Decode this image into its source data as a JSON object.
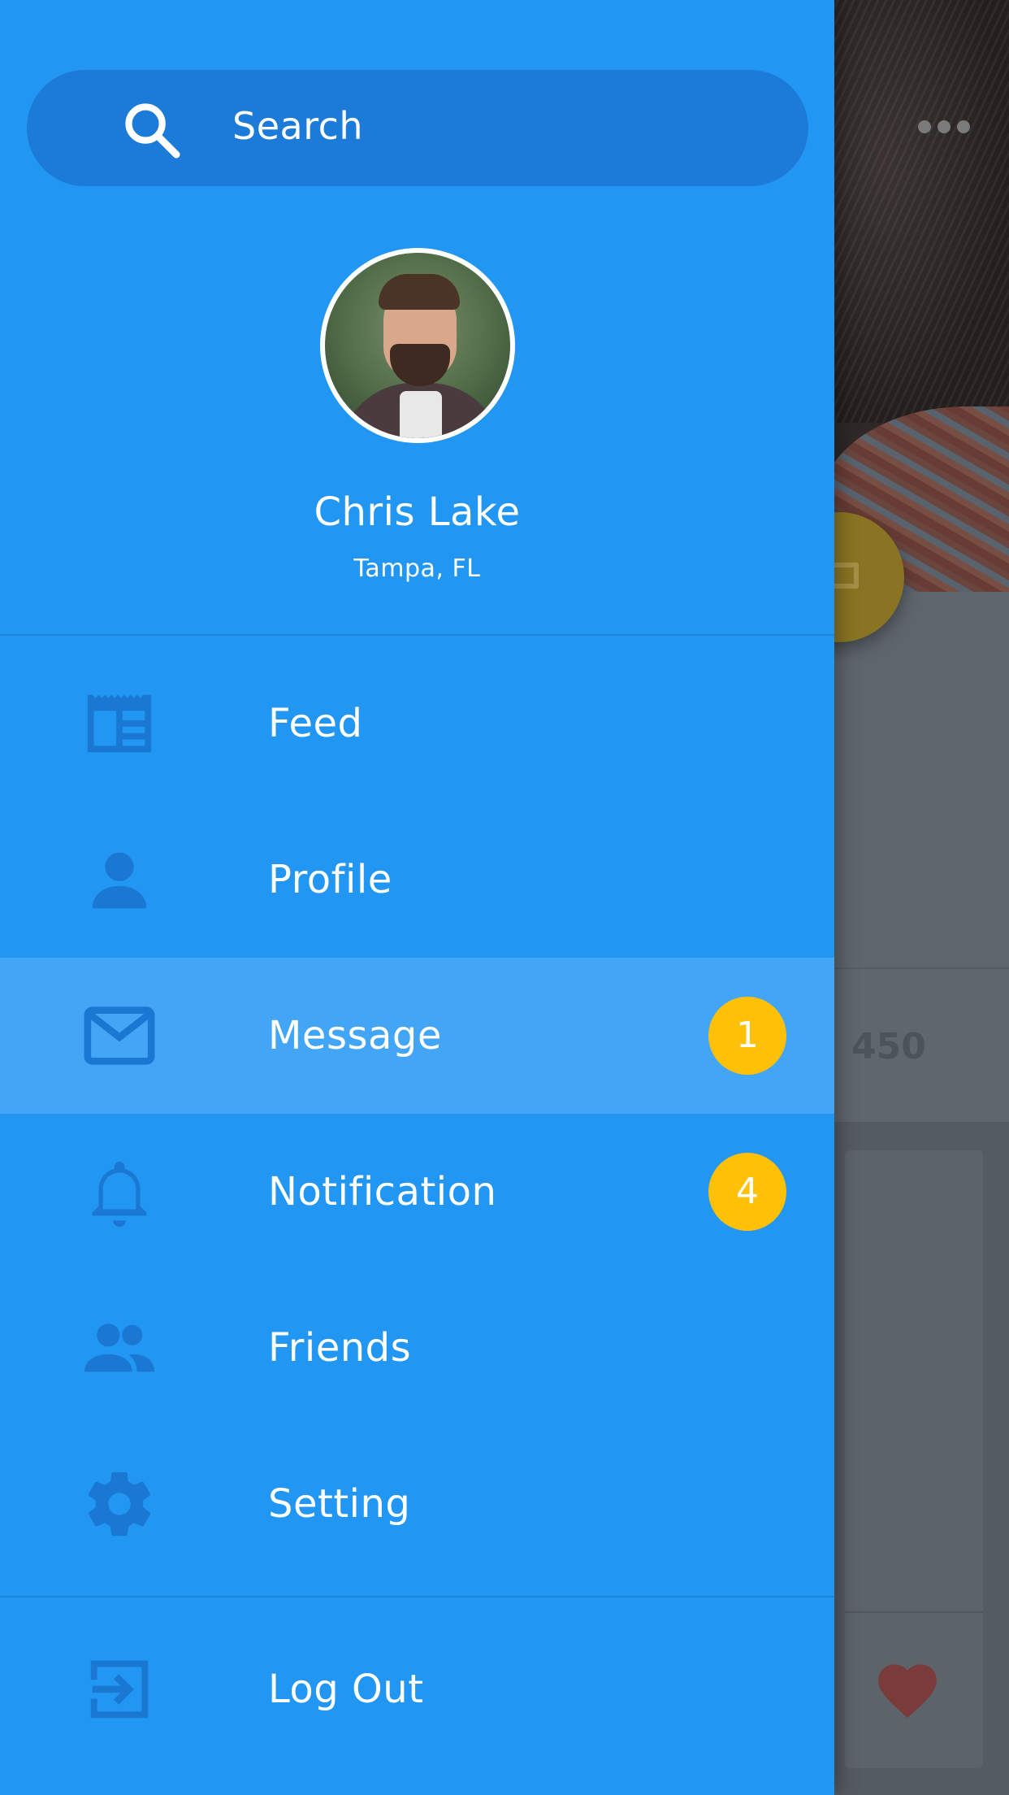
{
  "colors": {
    "drawer_bg": "#2196f3",
    "search_bg": "#1c7ad8",
    "active_bg": "#43a5f5",
    "icon_color": "#1a78d2",
    "badge_bg": "#ffc107",
    "overlay_bg": "#5f666d"
  },
  "search": {
    "label": "Search",
    "icon": "search-icon"
  },
  "profile": {
    "name": "Chris Lake",
    "location": "Tampa, FL"
  },
  "menu": {
    "items": [
      {
        "label": "Feed",
        "icon": "newspaper-icon",
        "badge": null,
        "active": false
      },
      {
        "label": "Profile",
        "icon": "person-icon",
        "badge": null,
        "active": false
      },
      {
        "label": "Message",
        "icon": "mail-icon",
        "badge": "1",
        "active": true
      },
      {
        "label": "Notification",
        "icon": "bell-icon",
        "badge": "4",
        "active": false
      },
      {
        "label": "Friends",
        "icon": "people-icon",
        "badge": null,
        "active": false
      },
      {
        "label": "Setting",
        "icon": "gear-icon",
        "badge": null,
        "active": false
      }
    ],
    "logout": {
      "label": "Log Out",
      "icon": "logout-icon"
    }
  },
  "background": {
    "stat_value": "450"
  }
}
